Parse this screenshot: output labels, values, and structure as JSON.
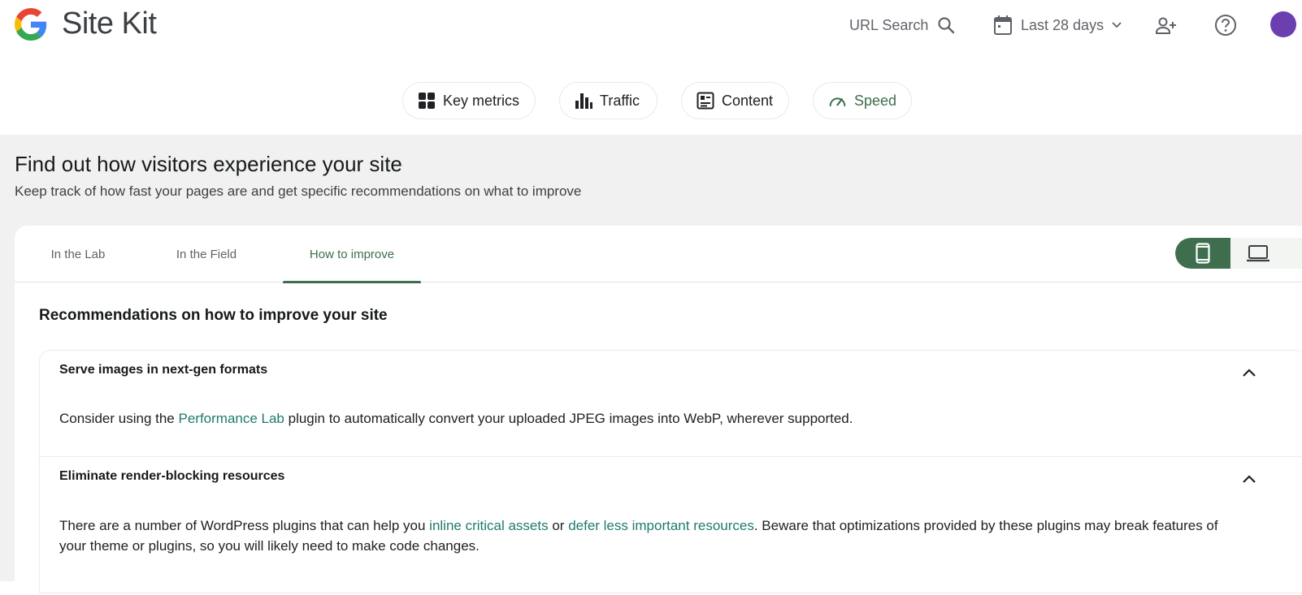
{
  "header": {
    "brand": "Site Kit",
    "url_search_label": "URL Search",
    "date_range_label": "Last 28 days"
  },
  "nav": {
    "chips": [
      {
        "label": "Key metrics"
      },
      {
        "label": "Traffic"
      },
      {
        "label": "Content"
      },
      {
        "label": "Speed",
        "active": true
      }
    ]
  },
  "section": {
    "title": "Find out how visitors experience your site",
    "subtitle": "Keep track of how fast your pages are and get specific recommendations on what to improve"
  },
  "tabs": [
    {
      "label": "In the Lab"
    },
    {
      "label": "In the Field"
    },
    {
      "label": "How to improve",
      "active": true
    }
  ],
  "recommendations": {
    "title": "Recommendations on how to improve your site",
    "items": [
      {
        "heading": "Serve images in next-gen formats",
        "text_1": "Consider using the ",
        "link_1": "Performance Lab",
        "text_2": " plugin to automatically convert your uploaded JPEG images into WebP, wherever supported."
      },
      {
        "heading": "Eliminate render-blocking resources",
        "text_1": "There are a number of WordPress plugins that can help you ",
        "link_1": "inline critical assets",
        "text_2": " or ",
        "link_2": "defer less important resources",
        "text_3": ". Beware that optimizations provided by these plugins may break features of your theme or plugins, so you will likely need to make code changes."
      }
    ]
  },
  "colors": {
    "accent": "#3e6e4d",
    "link": "#1f7a6f",
    "background_gray": "#f1f1f1"
  }
}
